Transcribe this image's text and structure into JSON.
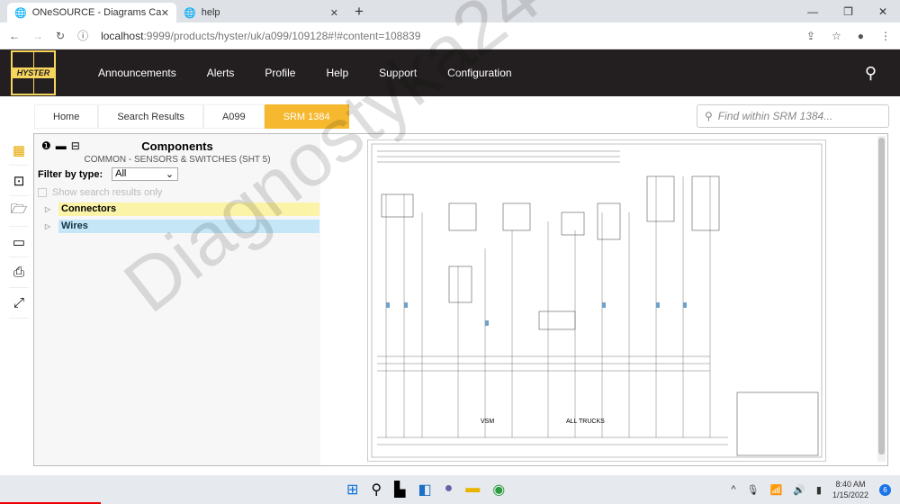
{
  "browser": {
    "tabs": [
      {
        "title": "ONeSOURCE - Diagrams Catalog"
      },
      {
        "title": "help"
      }
    ],
    "url_host": "localhost",
    "url_rest": ":9999/products/hyster/uk/a099/109128#!#content=108839"
  },
  "nav": {
    "logo_text": "HYSTER",
    "items": [
      "Announcements",
      "Alerts",
      "Profile",
      "Help",
      "Support",
      "Configuration"
    ]
  },
  "breadcrumb": [
    "Home",
    "Search Results",
    "A099",
    "SRM 1384"
  ],
  "search": {
    "placeholder": "Find within SRM 1384..."
  },
  "components": {
    "title": "Components",
    "subtitle": "COMMON - SENSORS & SWITCHES (SHT 5)",
    "filter_label": "Filter by type:",
    "filter_value": "All",
    "show_only": "Show search results only",
    "tree": [
      {
        "label": "Connectors",
        "color": "#fbf3a8"
      },
      {
        "label": "Wires",
        "color": "#c4e6f7"
      }
    ]
  },
  "diagram": {
    "labels": [
      "VSM",
      "ALL TRUCKS"
    ]
  },
  "taskbar": {
    "time": "8:40 AM",
    "date": "1/15/2022",
    "notifications": "6"
  },
  "watermark": "Diagnostyka24"
}
